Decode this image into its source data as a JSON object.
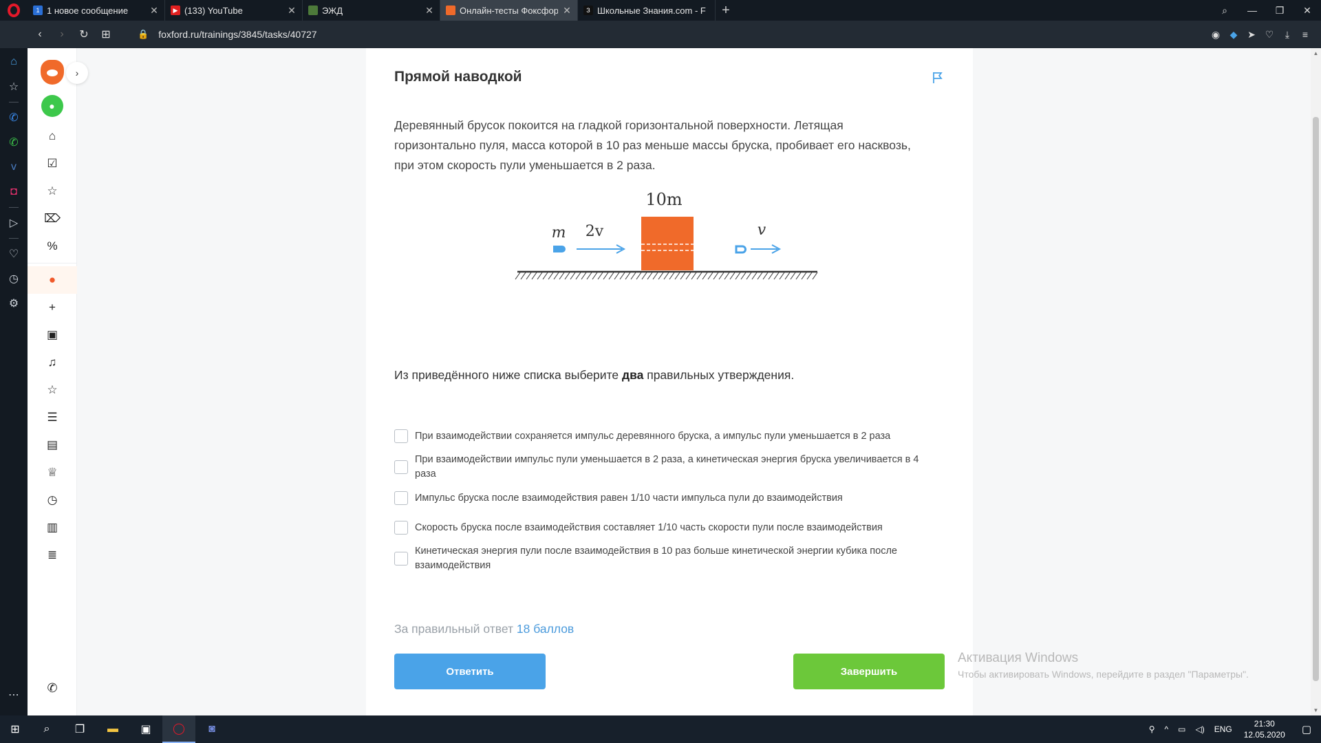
{
  "browser": {
    "tabs": [
      {
        "title": "1 новое сообщение",
        "fav": "1",
        "fav_color": "#2a6fd6"
      },
      {
        "title": "(133) YouTube",
        "fav": "▶",
        "fav_color": "#e02020"
      },
      {
        "title": "ЭЖД",
        "fav": "",
        "fav_color": "#4d7a3a"
      },
      {
        "title": "Онлайн-тесты Фоксфорд |",
        "fav": "",
        "fav_color": "#f06a2a"
      },
      {
        "title": "Школьные Знания.com - F",
        "fav": "З",
        "fav_color": "#111111"
      }
    ],
    "url": "foxford.ru/trainings/3845/tasks/40727"
  },
  "task": {
    "title": "Прямой наводкой",
    "problem": "Деревянный брусок покоится на гладкой горизонтальной поверхности. Летящая горизонтально пуля, масса которой в 10 раз меньше массы бруска, пробивает его насквозь, при этом скорость пули уменьшается в 2 раза.",
    "figure": {
      "block_mass": "10m",
      "bullet_mass": "m",
      "initial_speed": "2v",
      "final_speed": "v",
      "block_color": "#f06a2a",
      "bullet_color": "#4aa3e8"
    },
    "instruction_pre": "Из приведённого ниже списка выберите ",
    "instruction_bold": "два",
    "instruction_post": " правильных утверждения.",
    "options": [
      "При взаимодействии сохраняется импульс деревянного бруска, а импульс пули уменьшается в 2 раза",
      "При взаимодействии импульс пули уменьшается в 2 раза, а кинетическая энергия бруска увеличивается в 4 раза",
      "Импульс бруска после взаимодействия равен 1/10 части импульса пули до взаимодействия",
      "Скорость бруска после взаимодействия составляет 1/10 часть скорости пули после взаимодействия",
      "Кинетическая энергия пули после взаимодействия в 10 раз больше кинетической энергии кубика после взаимодействия"
    ],
    "points_label": "За правильный ответ ",
    "points_value": "18 баллов",
    "answer_button": "Ответить",
    "finish_button": "Завершить"
  },
  "activation": {
    "title": "Активация Windows",
    "subtitle": "Чтобы активировать Windows, перейдите в раздел \"Параметры\"."
  },
  "taskbar": {
    "lang": "ENG",
    "time": "21:30",
    "date": "12.05.2020"
  },
  "colors": {
    "answer": "#4aa3e8",
    "finish": "#6cc83a",
    "points": "#4c9bdc"
  }
}
